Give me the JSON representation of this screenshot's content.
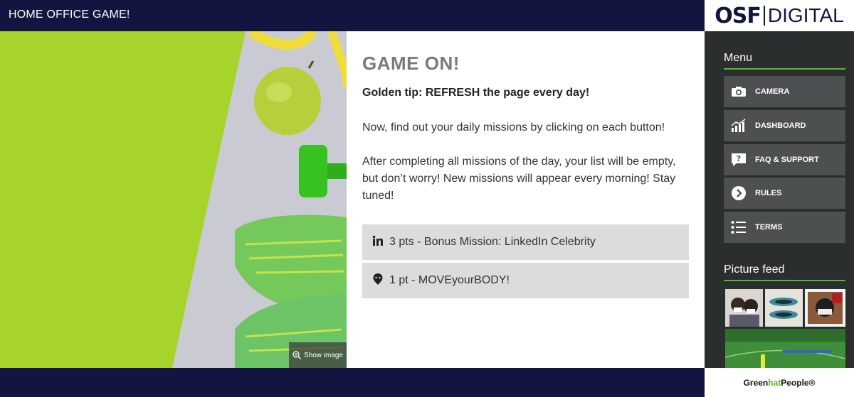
{
  "header": {
    "title": "HOME OFFICE GAME!"
  },
  "brand": {
    "logo_left": "OSF",
    "logo_right": "DIGITAL",
    "footer_green": "Green",
    "footer_hat": "hat",
    "footer_people": "People®"
  },
  "hero": {
    "show_image_label": "Show image"
  },
  "main": {
    "heading": "GAME ON!",
    "tip": "Golden tip: REFRESH the page every day!",
    "paragraph1": "Now, find out your daily missions by clicking on each button!",
    "paragraph2": "After completing all missions of the day, your list will be empty, but don’t worry! New missions will appear every morning! Stay tuned!",
    "missions": [
      {
        "label": "3 pts - Bonus Mission: LinkedIn Celebrity",
        "icon": "linkedin-icon"
      },
      {
        "label": "1 pt - MOVEyourBODY!",
        "icon": "map-pin-icon"
      }
    ]
  },
  "sidebar": {
    "menu_title": "Menu",
    "menu": [
      {
        "label": "CAMERA",
        "icon": "camera-icon"
      },
      {
        "label": "DASHBOARD",
        "icon": "bar-chart-icon"
      },
      {
        "label": "FAQ & SUPPORT",
        "icon": "question-bubble-icon"
      },
      {
        "label": "RULES",
        "icon": "chevron-right-circle-icon"
      },
      {
        "label": "TERMS",
        "icon": "list-icon"
      }
    ],
    "feed_title": "Picture feed"
  },
  "colors": {
    "navy": "#12153f",
    "accent_green": "#5cb82a",
    "sidebar_bg": "#2b2e2f",
    "menu_bg": "#4d5051",
    "mission_bg": "#dcdcdc",
    "heading_gray": "#7a7a7a"
  }
}
